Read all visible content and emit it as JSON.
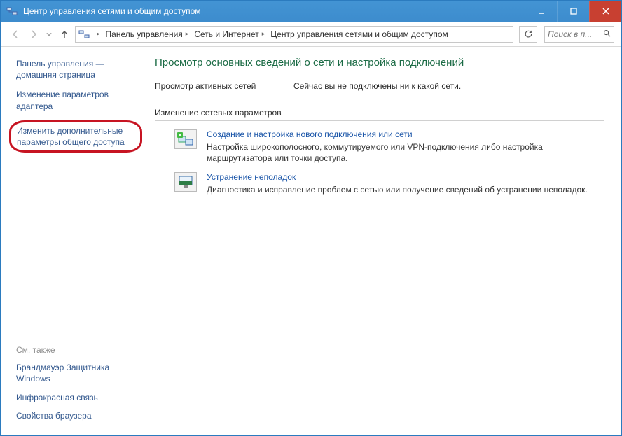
{
  "window": {
    "title": "Центр управления сетями и общим доступом"
  },
  "breadcrumb": {
    "seg1": "Панель управления",
    "seg2": "Сеть и Интернет",
    "seg3": "Центр управления сетями и общим доступом"
  },
  "search": {
    "placeholder": "Поиск в п..."
  },
  "sidebar": {
    "home": "Панель управления — домашняя страница",
    "adapter": "Изменение параметров адаптера",
    "advanced": "Изменить дополнительные параметры общего доступа",
    "seealso_label": "См. также",
    "seealso": {
      "firewall": "Брандмауэр Защитника Windows",
      "infrared": "Инфракрасная связь",
      "browser": "Свойства браузера"
    }
  },
  "main": {
    "heading": "Просмотр основных сведений о сети и настройка подключений",
    "active_label": "Просмотр активных сетей",
    "active_msg": "Сейчас вы не подключены ни к какой сети.",
    "change_label": "Изменение сетевых параметров",
    "item1": {
      "title": "Создание и настройка нового подключения или сети",
      "desc": "Настройка широкополосного, коммутируемого или VPN-подключения либо настройка маршрутизатора или точки доступа."
    },
    "item2": {
      "title": "Устранение неполадок",
      "desc": "Диагностика и исправление проблем с сетью или получение сведений об устранении неполадок."
    }
  }
}
